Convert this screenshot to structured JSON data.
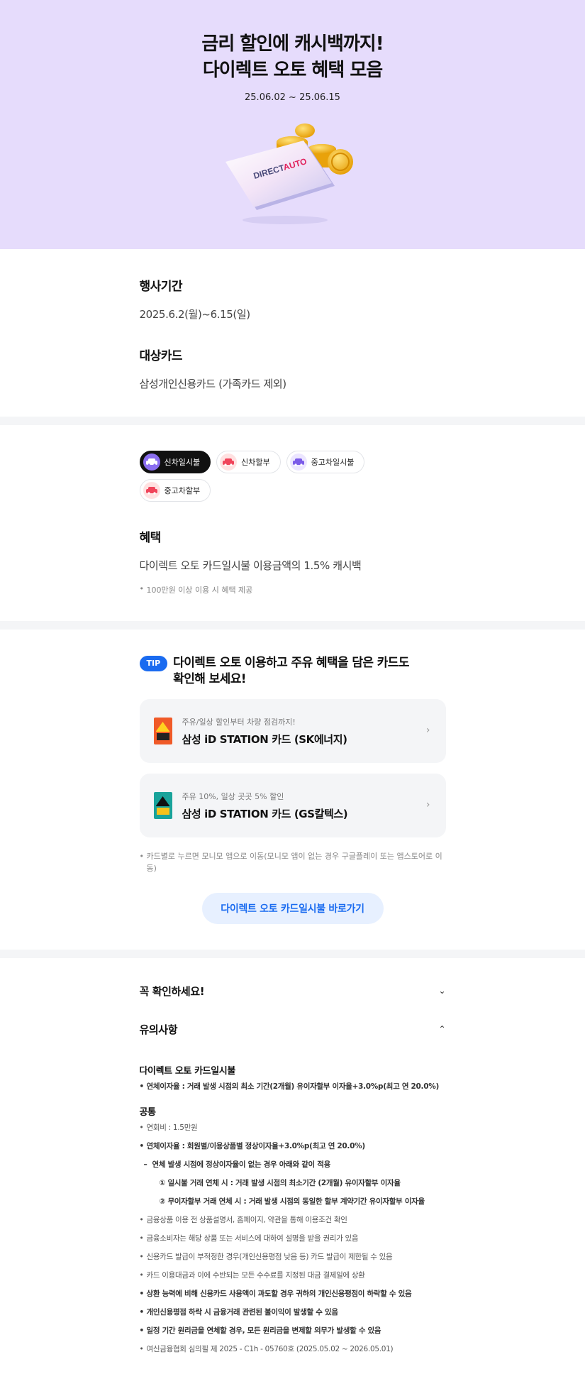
{
  "hero": {
    "title_line1": "금리 할인에 캐시백까지!",
    "title_line2": "다이렉트 오토 혜택 모음",
    "date": "25.06.02 ~ 25.06.15",
    "card_text": "DIRECTAUTO",
    "colors": {
      "background": "#e6dcfc",
      "coin": "#f5b712"
    }
  },
  "info": {
    "period_label": "행사기간",
    "period_value": "2025.6.2(월)~6.15(일)",
    "target_label": "대상카드",
    "target_value": "삼성개인신용카드 (가족카드 제외)"
  },
  "benefit": {
    "chips": [
      {
        "label": "신차일시불",
        "icon": "car-icon",
        "selected": true
      },
      {
        "label": "신차할부",
        "icon": "car-icon",
        "selected": false
      },
      {
        "label": "중고차일시불",
        "icon": "car-icon",
        "selected": false
      },
      {
        "label": "중고차할부",
        "icon": "car-icon",
        "selected": false
      }
    ],
    "title": "혜택",
    "description": "다이렉트 오토 카드일시불 이용금액의 1.5% 캐시백",
    "note": "100만원 이상 이용 시 혜택 제공"
  },
  "tip": {
    "badge": "TIP",
    "title_line1": "다이렉트 오토 이용하고 주유 혜택을 담은 카드도",
    "title_line2": "확인해 보세요!",
    "cards": [
      {
        "subtitle": "주유/일상 할인부터 차량 점검까지!",
        "name": "삼성 iD STATION 카드 (SK에너지)"
      },
      {
        "subtitle": "주유 10%, 일상 곳곳 5% 할인",
        "name": "삼성 iD STATION 카드 (GS칼텍스)"
      }
    ],
    "note": "카드별로 누르면 모니모 앱으로 이동(모니모 앱이 없는 경우 구글플레이 또는 앱스토어로 이동)",
    "cta": "다이렉트 오토 카드일시불 바로가기"
  },
  "notice": {
    "check_label": "꼭 확인하세요!",
    "caution_label": "유의사항",
    "section1_title": "다이렉트 오토 카드일시불",
    "section1_items": [
      "연체이자율 : 거래 발생 시점의 최소 기간(2개월) 유이자할부 이자율+3.0%p(최고 연 20.0%)"
    ],
    "section2_title": "공통",
    "items": {
      "fee": "연회비 : 1.5만원",
      "overdue": "연체이자율 : 회원별/이용상품별 정상이자율+3.0%p(최고 연 20.0%)",
      "overdue_sub": "연체 발생 시점에 정상이자율이 없는 경우 아래와 같이 적용",
      "overdue_sub1": "① 일시불 거래 연체 시 : 거래 발생 시점의 최소기간 (2개월) 유이자할부 이자율",
      "overdue_sub2": "② 무이자할부 거래 연체 시 : 거래 발생 시점의 동일한 할부 계약기간 유이자할부 이자율",
      "i1": "금융상품 이용 전 상품설명서, 홈페이지, 약관을 통해 이용조건 확인",
      "i2": "금융소비자는 해당 상품 또는 서비스에 대하여 설명을 받을 권리가 있음",
      "i3": "신용카드 발급이 부적정한 경우(개인신용평점 낮음 등) 카드 발급이 제한될 수 있음",
      "i4": "카드 이용대금과 이에 수반되는 모든 수수료를 지정된 대금 결제일에 상환",
      "i5": "상환 능력에 비해 신용카드 사용액이 과도할 경우 귀하의 개인신용평점이 하락할 수 있음",
      "i6": "개인신용평점 하락 시 금융거래 관련된 불이익이 발생할 수 있음",
      "i7": "일정 기간 원리금을 연체할 경우, 모든 원리금을 변제할 의무가 발생할 수 있음",
      "i8": "여신금융협회 심의필 제 2025 - C1h - 05760호 (2025.05.02 ~ 2026.05.01)"
    }
  }
}
